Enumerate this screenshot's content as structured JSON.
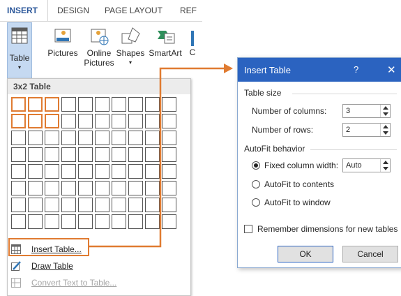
{
  "ribbon": {
    "tabs": [
      "INSERT",
      "DESIGN",
      "PAGE LAYOUT",
      "REF"
    ],
    "buttons": {
      "table": "Table",
      "pictures": "Pictures",
      "online_pictures_1": "Online",
      "online_pictures_2": "Pictures",
      "shapes": "Shapes",
      "smartart": "SmartArt",
      "cut": "C"
    }
  },
  "dropdown": {
    "title": "3x2 Table",
    "grid": {
      "columns": 10,
      "rows": 8,
      "selected_columns": 3,
      "selected_rows": 2
    },
    "items": [
      {
        "label": "Insert Table...",
        "enabled": true
      },
      {
        "label": "Draw Table",
        "enabled": true
      },
      {
        "label": "Convert Text to Table...",
        "enabled": false
      }
    ]
  },
  "dialog": {
    "title": "Insert Table",
    "help": "?",
    "close": "✕",
    "table_size": {
      "heading": "Table size",
      "columns_label": "Number of columns:",
      "columns_value": "3",
      "rows_label": "Number of rows:",
      "rows_value": "2"
    },
    "autofit": {
      "heading": "AutoFit behavior",
      "fixed_label": "Fixed column width:",
      "fixed_value": "Auto",
      "contents_label": "AutoFit to contents",
      "window_label": "AutoFit to window",
      "selected": "fixed"
    },
    "remember_label": "Remember dimensions for new tables",
    "remember_checked": false,
    "ok": "OK",
    "cancel": "Cancel"
  },
  "colors": {
    "accent": "#e07b31",
    "title_bar": "#2b63c0",
    "selected_button": "#c5d9f1",
    "tab_active": "#2b579a"
  }
}
